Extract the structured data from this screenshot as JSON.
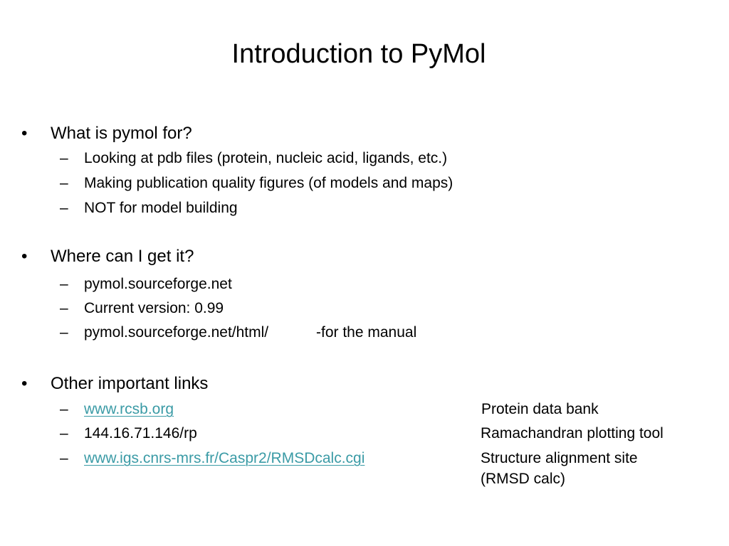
{
  "title": "Introduction to PyMol",
  "bullet_glyph": "•",
  "dash_glyph": "–",
  "sections": [
    {
      "heading": "What is pymol for?",
      "items": [
        "Looking at pdb files (protein, nucleic acid, ligands, etc.)",
        "Making publication quality figures (of models and maps)",
        "NOT for model building"
      ]
    },
    {
      "heading": "Where can I get it?",
      "items": [
        "pymol.sourceforge.net",
        "Current version: 0.99",
        "pymol.sourceforge.net/html/"
      ],
      "manual_note": "-for the manual"
    },
    {
      "heading": "Other important links",
      "links": [
        {
          "text": "www.rcsb.org",
          "description": "Protein data bank"
        },
        {
          "text": "144.16.71.146/rp",
          "description": "Ramachandran plotting tool"
        },
        {
          "text": "www.igs.cnrs-mrs.fr/Caspr2/RMSDcalc.cgi",
          "description": "Structure alignment site",
          "description_line2": "(RMSD calc)"
        }
      ]
    }
  ],
  "colors": {
    "link": "#3b9ba6",
    "text": "#000000",
    "background": "#ffffff"
  }
}
